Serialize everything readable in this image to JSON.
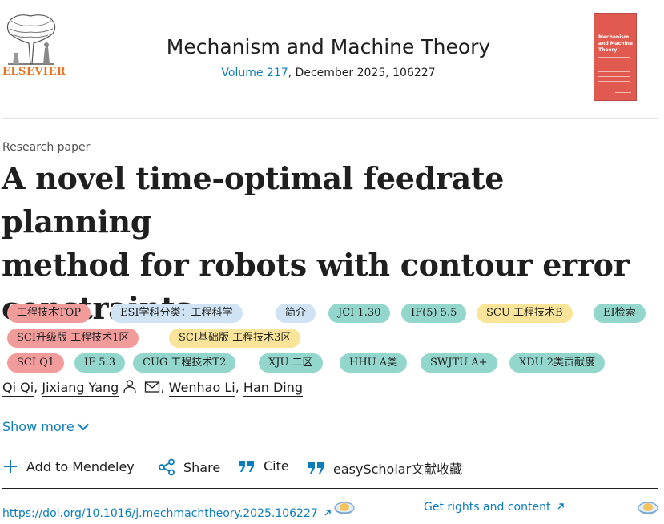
{
  "publisher": {
    "name": "ELSEVIER",
    "logo_icon": "elsevier-tree-logo"
  },
  "journal": {
    "title": "Mechanism and Machine Theory",
    "volume_link": "Volume 217",
    "issue_rest": ", December 2025, 106227",
    "cover_title": "Mechanism and Machine Theory"
  },
  "article": {
    "type": "Research paper",
    "title_lines": [
      "A novel time-optimal feedrate planning",
      "method for robots with contour error",
      "constraints"
    ]
  },
  "tags": [
    {
      "label": "工程技术TOP",
      "color": "#f19b9b"
    },
    {
      "label": "ESI学科分类：工程科学",
      "color": "#cfe3f5"
    },
    {
      "label": "简介",
      "color": "#cfe3f5"
    },
    {
      "label": "JCI 1.30",
      "color": "#93d6cc"
    },
    {
      "label": "IF(5) 5.5",
      "color": "#93d6cc"
    },
    {
      "label": "SCU 工程技术B",
      "color": "#f9e49a"
    },
    {
      "label": "EI检索",
      "color": "#93d6cc"
    },
    {
      "label": "SCI升级版 工程技术1区",
      "color": "#f19b9b"
    },
    {
      "label": "SCI基础版 工程技术3区",
      "color": "#f9e49a"
    },
    {
      "label": "SCI Q1",
      "color": "#f19b9b"
    },
    {
      "label": "IF 5.3",
      "color": "#93d6cc"
    },
    {
      "label": "CUG 工程技术T2",
      "color": "#93d6cc"
    },
    {
      "label": "XJU 二区",
      "color": "#93d6cc"
    },
    {
      "label": "HHU A类",
      "color": "#93d6cc"
    },
    {
      "label": "SWJTU A+",
      "color": "#93d6cc"
    },
    {
      "label": "XDU 2类贡献度",
      "color": "#93d6cc"
    }
  ],
  "authors": {
    "a1": "Qi Qi",
    "a2": "Jixiang Yang",
    "a3": "Wenhao Li",
    "a4": "Han Ding",
    "sep": ",",
    "person_icon": "person-icon",
    "mail_icon": "envelope-icon"
  },
  "show_more": "Show more",
  "actions": {
    "mendeley": "Add to Mendeley",
    "share": "Share",
    "cite": "Cite",
    "easyscholar": "easyScholar文献收藏"
  },
  "links": {
    "doi": "https://doi.org/10.1016/j.mechmachtheory.2025.106227",
    "rights": "Get rights and content"
  },
  "colors": {
    "link": "#0c7dbb",
    "elsevier_orange": "#e9711c"
  }
}
